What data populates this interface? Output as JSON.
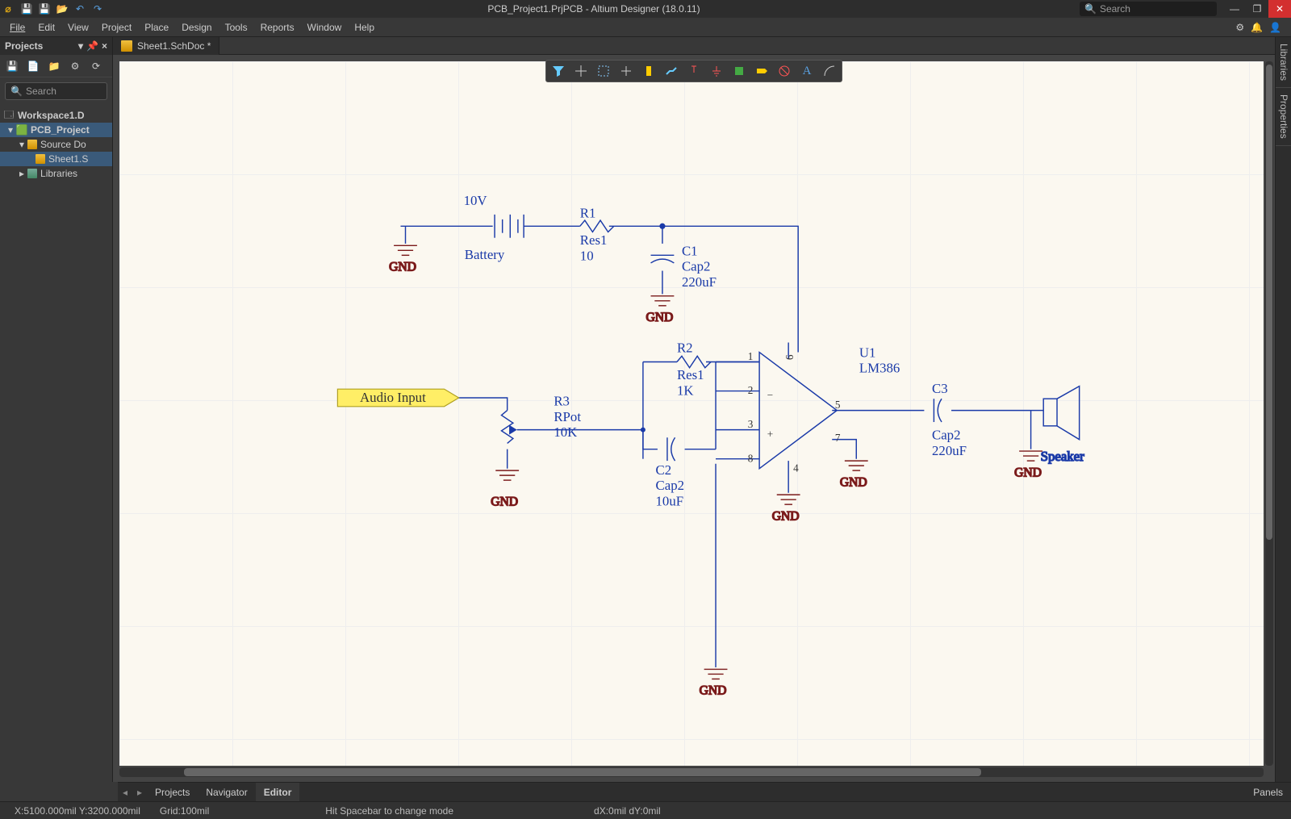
{
  "titlebar": {
    "title": "PCB_Project1.PrjPCB - Altium Designer (18.0.11)",
    "search_placeholder": "Search"
  },
  "menu": [
    "File",
    "Edit",
    "View",
    "Project",
    "Place",
    "Design",
    "Tools",
    "Reports",
    "Window",
    "Help"
  ],
  "projects_panel": {
    "title": "Projects",
    "search_placeholder": "Search",
    "workspace": "Workspace1.D",
    "project": "PCB_Project",
    "source_docs": "Source Do",
    "sheet": "Sheet1.S",
    "libraries": "Libraries",
    "footer_tabs": [
      "Projects",
      "Navigator"
    ]
  },
  "tab": {
    "label": "Sheet1.SchDoc *"
  },
  "right_tabs": [
    "Libraries",
    "Properties"
  ],
  "editor_tabs": {
    "items": [
      "Projects",
      "Navigator",
      "Editor"
    ],
    "active": "Editor",
    "panels": "Panels"
  },
  "status": {
    "coords": "X:5100.000mil Y:3200.000mil",
    "grid": "Grid:100mil",
    "hint": "Hit Spacebar to change mode",
    "delta": "dX:0mil dY:0mil"
  },
  "schematic": {
    "battery": {
      "voltage": "10V",
      "name": "Battery"
    },
    "r1": {
      "des": "R1",
      "type": "Res1",
      "val": "10"
    },
    "c1": {
      "des": "C1",
      "type": "Cap2",
      "val": "220uF"
    },
    "r2": {
      "des": "R2",
      "type": "Res1",
      "val": "1K"
    },
    "r3": {
      "des": "R3",
      "type": "RPot",
      "val": "10K"
    },
    "c2": {
      "des": "C2",
      "type": "Cap2",
      "val": "10uF"
    },
    "u1": {
      "des": "U1",
      "type": "LM386"
    },
    "c3": {
      "des": "C3",
      "type": "Cap2",
      "val": "220uF"
    },
    "speaker": "Speaker",
    "audio_in": "Audio Input",
    "gnd": "GND",
    "pins": {
      "p1": "1",
      "p2": "2",
      "p3": "3",
      "p5": "5",
      "p6": "6",
      "p7": "7",
      "p8": "8",
      "p4": "4"
    }
  }
}
